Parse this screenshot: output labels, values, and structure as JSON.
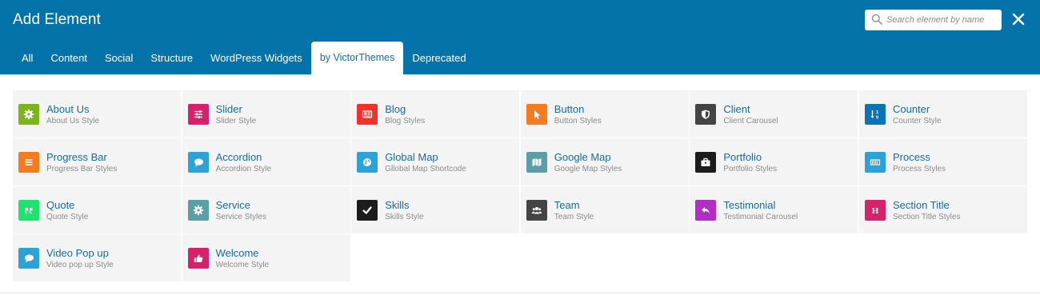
{
  "header": {
    "title": "Add Element",
    "search_placeholder": "Search element by name",
    "search_value": "",
    "background_color": "#0473aa"
  },
  "tabs": [
    {
      "label": "All",
      "active": false
    },
    {
      "label": "Content",
      "active": false
    },
    {
      "label": "Social",
      "active": false
    },
    {
      "label": "Structure",
      "active": false
    },
    {
      "label": "WordPress Widgets",
      "active": false
    },
    {
      "label": "by VictorThemes",
      "active": true
    },
    {
      "label": "Deprecated",
      "active": false
    }
  ],
  "elements": [
    {
      "name": "About Us",
      "desc": "About Us Style",
      "icon": "gear-icon",
      "color": "#7cb518"
    },
    {
      "name": "Slider",
      "desc": "Slider Style",
      "icon": "sliders-icon",
      "color": "#d6226a"
    },
    {
      "name": "Blog",
      "desc": "Blog Styles",
      "icon": "newspaper-icon",
      "color": "#f0322a"
    },
    {
      "name": "Button",
      "desc": "Button Styles",
      "icon": "cursor-icon",
      "color": "#f47b20"
    },
    {
      "name": "Client",
      "desc": "Client Carousel",
      "icon": "shield-icon",
      "color": "#444444"
    },
    {
      "name": "Counter",
      "desc": "Counter Style",
      "icon": "sort-numeric-icon",
      "color": "#0b73b6"
    },
    {
      "name": "Progress Bar",
      "desc": "Progress Bar Styles",
      "icon": "list-icon",
      "color": "#f47b20"
    },
    {
      "name": "Accordion",
      "desc": "Accordion Style",
      "icon": "comments-icon",
      "color": "#2ba3d8"
    },
    {
      "name": "Global Map",
      "desc": "Gllobal Map Shortcode",
      "icon": "globe-icon",
      "color": "#2ba3d8"
    },
    {
      "name": "Google Map",
      "desc": "Google Map Styles",
      "icon": "map-icon",
      "color": "#5a9fa8"
    },
    {
      "name": "Portfolio",
      "desc": "Portfolio Styles",
      "icon": "briefcase-icon",
      "color": "#1c1c1c"
    },
    {
      "name": "Process",
      "desc": "Process Styles",
      "icon": "progress-bar-icon",
      "color": "#2ba3d8"
    },
    {
      "name": "Quote",
      "desc": "Quote Style",
      "icon": "quote-icon",
      "color": "#1ee36f"
    },
    {
      "name": "Service",
      "desc": "Service Styles",
      "icon": "gear-icon",
      "color": "#5a9fa8"
    },
    {
      "name": "Skills",
      "desc": "Skills Style",
      "icon": "check-icon",
      "color": "#1c1c1c"
    },
    {
      "name": "Team",
      "desc": "Team Style",
      "icon": "users-icon",
      "color": "#444444"
    },
    {
      "name": "Testimonial",
      "desc": "Testimonial Carousel",
      "icon": "reply-icon",
      "color": "#b02ec4"
    },
    {
      "name": "Section Title",
      "desc": "Section Title Styles",
      "icon": "heading-icon",
      "color": "#d6226a"
    },
    {
      "name": "Video Pop up",
      "desc": "Video pop up Style",
      "icon": "comments-icon",
      "color": "#2ba3d8"
    },
    {
      "name": "Welcome",
      "desc": "Welcome Style",
      "icon": "thumbs-up-icon",
      "color": "#d6226a"
    }
  ]
}
